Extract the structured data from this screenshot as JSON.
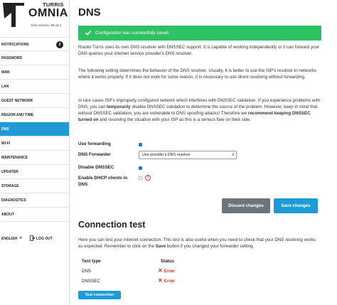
{
  "sidebar": {
    "brand_top": "TURRIS",
    "brand_main": "OMNIA",
    "version": "foris version: 98.19.1",
    "items": [
      {
        "label": "NOTIFICATIONS",
        "badge": "2"
      },
      {
        "label": "PASSWORD"
      },
      {
        "label": "WAN"
      },
      {
        "label": "LAN"
      },
      {
        "label": "GUEST NETWORK"
      },
      {
        "label": "REGION AND TIME"
      },
      {
        "label": "DNS",
        "active": true
      },
      {
        "label": "WI-FI"
      },
      {
        "label": "MAINTENANCE"
      },
      {
        "label": "UPDATER"
      },
      {
        "label": "STORAGE"
      },
      {
        "label": "DIAGNOSTICS"
      },
      {
        "label": "ABOUT"
      }
    ],
    "language": "ENGLISH",
    "logout": "LOG OUT"
  },
  "main": {
    "title": "DNS",
    "alert": "Configuration was successfully saved.",
    "para1": "Router Turris uses its own DNS resolver with DNSSEC support. It is capable of working independently or it can forward your DNS queries your internet service provider's DNS resolver.",
    "para2": "The following setting determines the behavior of the DNS resolver. Usually, it is better to use the ISP's resolver in networks where it works properly. If it does not work for some reason, it is necessary to use direct resolving without forwarding.",
    "para3": {
      "a": "In rare cases ISP's improperly configured network which interferes with DNSSEC validation. If you experience problems with DNS, you can ",
      "b": "temporarily",
      "c": " disable DNSSEC validation to determine the source of the problem. However, keep in mind that without DNSSEC validation, you are vulnerable to DNS spoofing attacks! Therefore we ",
      "d": "recommend keeping DNSSEC turned on",
      "e": " and resolving the situation with your ISP as this is a serious flaw on their side."
    },
    "form": {
      "forwarding_label": "Use forwarding",
      "forwarder_label": "DNS Forwarder",
      "forwarder_value": "Use provider's DNS resolver",
      "dnssec_label": "Disable DNSSEC",
      "dhcp_label": "Enable DHCP clients in DNS"
    },
    "buttons": {
      "discard": "Discard changes",
      "save": "Save changes"
    },
    "connection": {
      "title": "Connection test",
      "para": {
        "a": "Here you can test your internet connection. This test is also useful when you need to check that your DNS resolving works as expected. Remember to click on the ",
        "b": "Save",
        "c": " button if you changed your forwarder setting."
      },
      "columns": [
        "Test type",
        "Status"
      ],
      "rows": [
        {
          "name": "DNS",
          "status": "Error"
        },
        {
          "name": "DNSSEC",
          "status": "Error"
        }
      ],
      "button": "Test connection"
    }
  },
  "colors": {
    "accent": "#1e9ad6",
    "success": "#2ec262",
    "error": "#d33333",
    "secondary": "#6c757d"
  }
}
